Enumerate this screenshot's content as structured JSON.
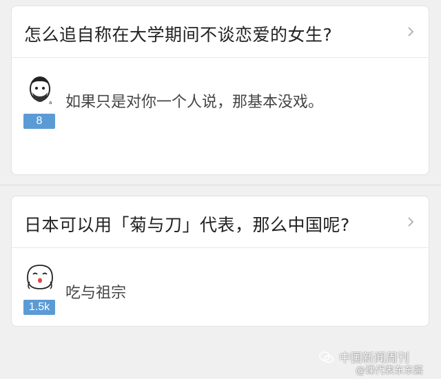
{
  "questions": [
    {
      "title": "怎么追自称在大学期间不谈恋爱的女生?",
      "answer_text": "如果只是对你一个人说，那基本没戏。",
      "vote_count": "8",
      "avatar": "bearded-man-avatar"
    },
    {
      "title": "日本可以用「菊与刀」代表，那么中国呢?",
      "answer_text": "吃与祖宗",
      "vote_count": "1.5k",
      "avatar": "cartoon-face-avatar"
    }
  ],
  "watermark": {
    "name": "中国新闻周刊",
    "sub": "@课代表东东酱"
  },
  "colors": {
    "badge": "#5b9bd5",
    "background": "#f0f0f0",
    "card": "#ffffff"
  }
}
